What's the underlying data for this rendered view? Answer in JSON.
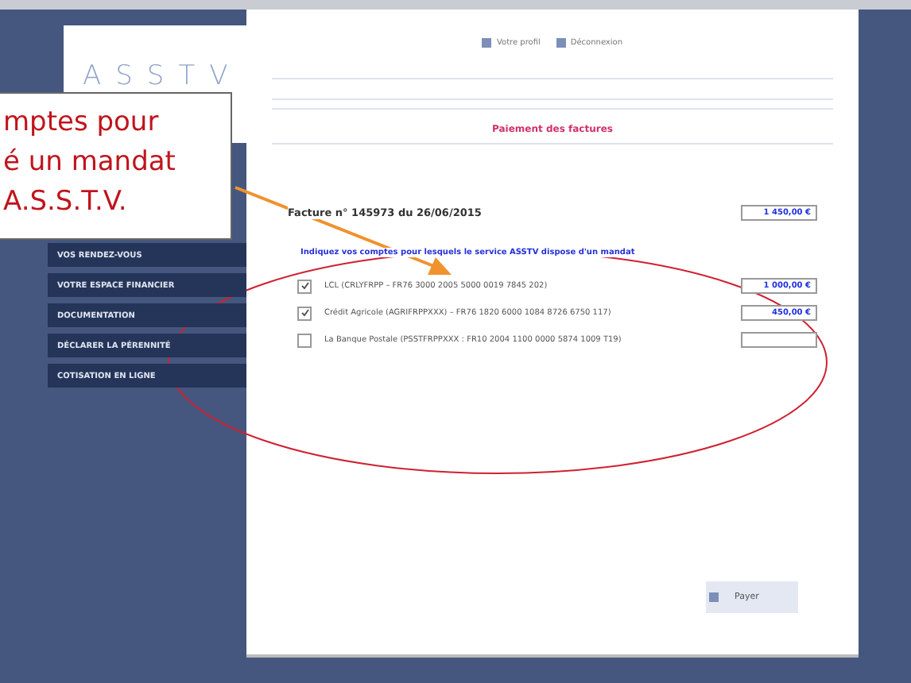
{
  "header": {
    "logo": "ASSTV",
    "links": [
      "Votre profil",
      "Déconnexion"
    ]
  },
  "nav": {
    "items": [
      {
        "label": "VOS RENDEZ-VOUS"
      },
      {
        "label": "VOTRE ESPACE FINANCIER"
      },
      {
        "label": "DOCUMENTATION"
      },
      {
        "label": "DÉCLARER LA PÉRENNITÉ"
      },
      {
        "label": "COTISATION EN LIGNE"
      }
    ]
  },
  "page_title": "Paiement des factures",
  "invoice": {
    "label": "Facture n° 145973 du 26/06/2015",
    "amount": "1 450,00 €"
  },
  "accounts_hint": "Indiquez vos comptes pour lesquels le service ASSTV dispose d'un mandat",
  "accounts": [
    {
      "label": "LCL (CRLYFRPP – FR76 3000 2005 5000 0019 7845 202)",
      "checked": true,
      "amount": "1 000,00 €"
    },
    {
      "label": "Crédit Agricole (AGRIFRPPXXX) – FR76 1820 6000 1084 8726 6750 117)",
      "checked": true,
      "amount": "450,00 €"
    },
    {
      "label": "La Banque Postale (PSSTFRPPXXX : FR10 2004 1100 0000 5874 1009 T19)",
      "checked": false
    }
  ],
  "pay_button": "Payer",
  "callout": {
    "lines": [
      "mptes pour",
      "é un mandat",
      "A.S.S.T.V."
    ]
  }
}
